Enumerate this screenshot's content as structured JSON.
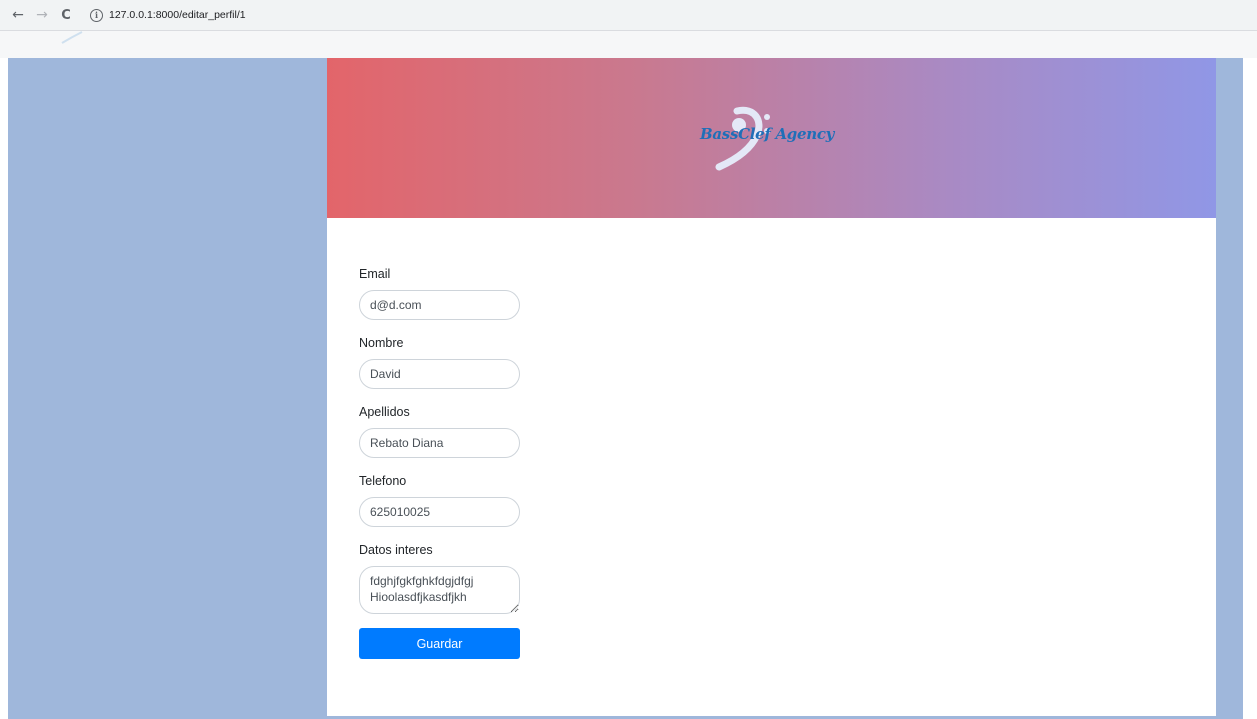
{
  "browser": {
    "back_icon": "←",
    "forward_icon": "→",
    "reload_icon": "C",
    "info_icon": "i",
    "url": "127.0.0.1:8000/editar_perfil/1"
  },
  "brand": {
    "logo_text": "BassClef Agency",
    "accent_color": "#1f6fb8"
  },
  "form": {
    "email": {
      "label": "Email",
      "value": "d@d.com"
    },
    "nombre": {
      "label": "Nombre",
      "value": "David"
    },
    "apellidos": {
      "label": "Apellidos",
      "value": "Rebato Diana"
    },
    "telefono": {
      "label": "Telefono",
      "value": "625010025"
    },
    "datos": {
      "label": "Datos interes",
      "value": "fdghjfgkfghkfdgjdfgj\nHioolasdfjkasdfjkh"
    },
    "submit_label": "Guardar",
    "submit_color": "#007bff"
  },
  "colors": {
    "page_background": "#9fb7db",
    "hero_gradient_start": "#e3656a",
    "hero_gradient_end": "#9097e6"
  }
}
